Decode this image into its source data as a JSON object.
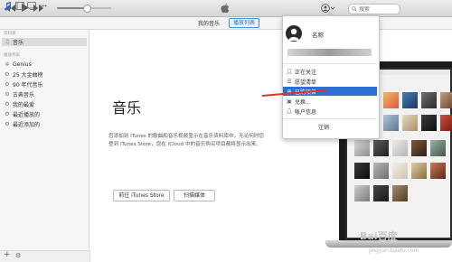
{
  "titlebar": {
    "prev_icon": "rewind-icon",
    "play_icon": "play-icon",
    "next_icon": "fast-forward-icon",
    "progress": 0.55,
    "search_placeholder": "搜索"
  },
  "toolbar": {
    "tabs": [
      {
        "label": "我的音乐"
      },
      {
        "label": "播放列表"
      }
    ]
  },
  "sidebar": {
    "library_header": "资料库",
    "library_items": [
      {
        "label": "音乐",
        "icon": "music-note-icon"
      }
    ],
    "playlists_header": "播放列表",
    "playlist_items": [
      {
        "label": "Genius",
        "icon": "genius-icon"
      },
      {
        "label": "25 大金曲榜",
        "icon": "gear-icon"
      },
      {
        "label": "90 年代音乐",
        "icon": "gear-icon"
      },
      {
        "label": "古典音乐",
        "icon": "gear-icon"
      },
      {
        "label": "我的最爱",
        "icon": "gear-icon"
      },
      {
        "label": "最近播放的",
        "icon": "gear-icon"
      },
      {
        "label": "最近添加的",
        "icon": "gear-icon"
      }
    ],
    "bottom_add": "+",
    "bottom_settings": "⚙"
  },
  "main": {
    "heading": "音乐",
    "description_lines": [
      "您添加到 iTunes 的歌曲和音乐视频显示在音乐资料库中。无论何时您",
      "登到 iTunes Store，您在 iCloud 中的音乐购买项目都将显示出来。"
    ],
    "store_button": "前往 iTunes Store",
    "scan_button": "扫描媒体"
  },
  "account_menu": {
    "name": "名称",
    "items": [
      {
        "label": "正在关注",
        "icon": "person-icon"
      },
      {
        "label": "愿望清单",
        "icon": "list-icon"
      },
      {
        "label": "已购项目",
        "icon": "purchased-icon",
        "highlighted": true
      },
      {
        "label": "兑换...",
        "icon": "gift-icon"
      },
      {
        "label": "帐户信息",
        "icon": "person-icon"
      }
    ],
    "logout": "注销"
  },
  "watermark": {
    "logo": "Bai百度",
    "url": "jingyan.baidu.com"
  },
  "colors": {
    "accent": "#2e6fd6",
    "tab_border": "#4a90d9",
    "annotation": "#e03030"
  }
}
